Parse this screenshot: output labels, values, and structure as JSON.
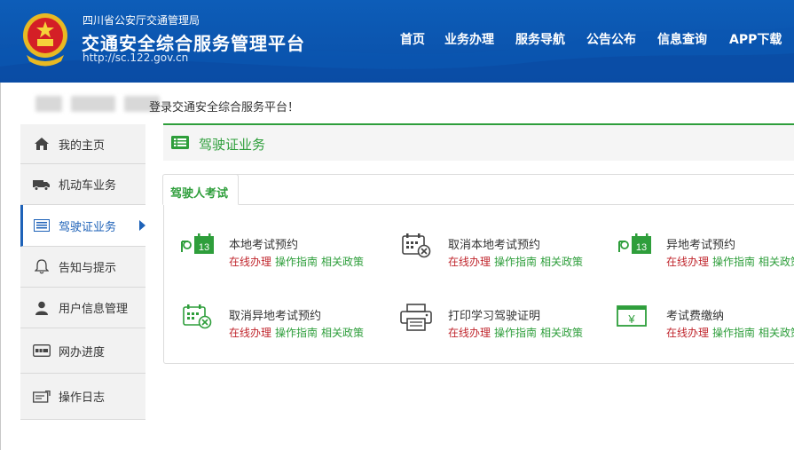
{
  "header": {
    "org_name": "四川省公安厅交通管理局",
    "platform_title": "交通安全综合服务管理平台",
    "url": "http://sc.122.gov.cn",
    "nav": [
      "首页",
      "业务办理",
      "服务导航",
      "公告公布",
      "信息查询",
      "APP下载"
    ]
  },
  "welcome": {
    "text": "登录交通安全综合服务平台！"
  },
  "sidebar": {
    "items": [
      {
        "label": "我的主页",
        "icon": "home-icon"
      },
      {
        "label": "机动车业务",
        "icon": "truck-icon"
      },
      {
        "label": "驾驶证业务",
        "icon": "id-card-icon",
        "active": true
      },
      {
        "label": "告知与提示",
        "icon": "bell-icon"
      },
      {
        "label": "用户信息管理",
        "icon": "user-icon"
      },
      {
        "label": "网办进度",
        "icon": "progress-icon"
      },
      {
        "label": "操作日志",
        "icon": "log-icon"
      }
    ]
  },
  "panel": {
    "title": "驾驶证业务",
    "tab": "驾驶人考试"
  },
  "services": [
    {
      "name": "本地考试预约",
      "icon": "calendar-13-icon"
    },
    {
      "name": "取消本地考试预约",
      "icon": "calendar-cancel-icon"
    },
    {
      "name": "异地考试预约",
      "icon": "calendar-13-icon"
    },
    {
      "name": "取消异地考试预约",
      "icon": "calendar-cancel-icon"
    },
    {
      "name": "打印学习驾驶证明",
      "icon": "printer-icon"
    },
    {
      "name": "考试费缴纳",
      "icon": "yen-payment-icon"
    }
  ],
  "links": {
    "online": "在线办理",
    "guide": "操作指南",
    "policy": "相关政策"
  },
  "colors": {
    "header_blue": "#0a4fa8",
    "accent_green": "#2e9e3b",
    "link_red": "#c0262d",
    "active_blue": "#1e62b8"
  }
}
